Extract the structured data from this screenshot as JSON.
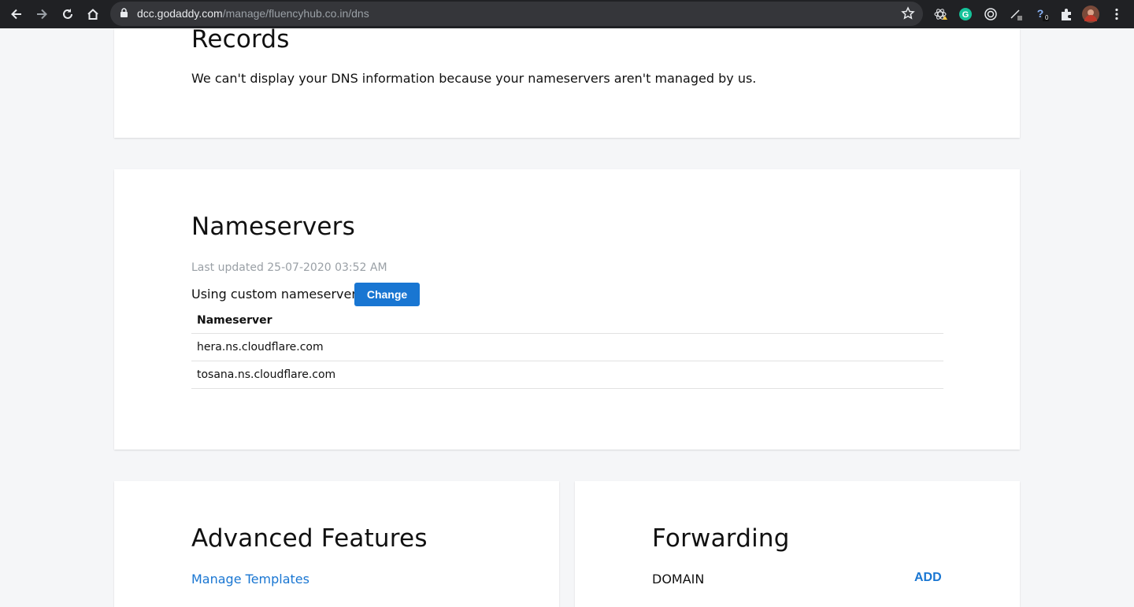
{
  "browser": {
    "url_host": "dcc.godaddy.com",
    "url_path": "/manage/fluencyhub.co.in/dns",
    "extension_badge": "0"
  },
  "records": {
    "title": "Records",
    "message": "We can't display your DNS information because your nameservers aren't managed by us."
  },
  "nameservers": {
    "title": "Nameservers",
    "last_updated": "Last updated 25-07-2020 03:52 AM",
    "status": "Using custom nameservers",
    "change_label": "Change",
    "column_header": "Nameserver",
    "rows": [
      "hera.ns.cloudflare.com",
      "tosana.ns.cloudflare.com"
    ]
  },
  "advanced": {
    "title": "Advanced Features",
    "manage_templates": "Manage Templates"
  },
  "forwarding": {
    "title": "Forwarding",
    "domain_label": "DOMAIN",
    "add_label": "ADD"
  },
  "colors": {
    "accent": "#1976d2",
    "chrome_bg": "#202124",
    "page_bg": "#f5f6f8"
  }
}
